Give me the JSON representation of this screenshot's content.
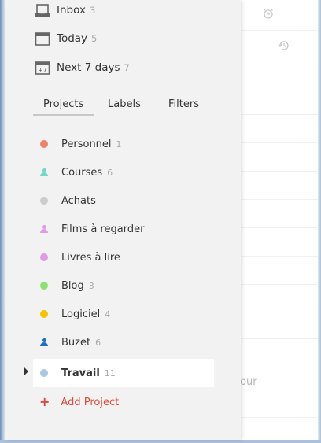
{
  "filters": [
    {
      "label": "Inbox",
      "count": "3",
      "icon": "inbox-icon"
    },
    {
      "label": "Today",
      "count": "5",
      "icon": "calendar-today-icon"
    },
    {
      "label": "Next 7 days",
      "count": "7",
      "icon": "calendar-next7-icon",
      "badge": "+7"
    }
  ],
  "tabs": [
    {
      "label": "Projects",
      "active": true
    },
    {
      "label": "Labels",
      "active": false
    },
    {
      "label": "Filters",
      "active": false
    }
  ],
  "projects": [
    {
      "label": "Personnel",
      "count": "1",
      "color": "#f0806a",
      "kind": "dot"
    },
    {
      "label": "Courses",
      "count": "6",
      "color": "#6ed8c6",
      "kind": "person"
    },
    {
      "label": "Achats",
      "count": "",
      "color": "#cccccc",
      "kind": "dot"
    },
    {
      "label": "Films à regarder",
      "count": "",
      "color": "#e09ae6",
      "kind": "person"
    },
    {
      "label": "Livres à lire",
      "count": "",
      "color": "#e09ae6",
      "kind": "dot"
    },
    {
      "label": "Blog",
      "count": "3",
      "color": "#8be26e",
      "kind": "dot"
    },
    {
      "label": "Logiciel",
      "count": "4",
      "color": "#f5c400",
      "kind": "dot"
    },
    {
      "label": "Buzet",
      "count": "6",
      "color": "#1f6cc0",
      "kind": "person"
    },
    {
      "label": "Travail",
      "count": "11",
      "color": "#a9c7e3",
      "kind": "dot",
      "selected": true
    }
  ],
  "add_project": {
    "label": "Add Project",
    "icon": "plus-icon",
    "color": "#dc4c3e"
  },
  "main": {
    "partial_text": "tour"
  }
}
